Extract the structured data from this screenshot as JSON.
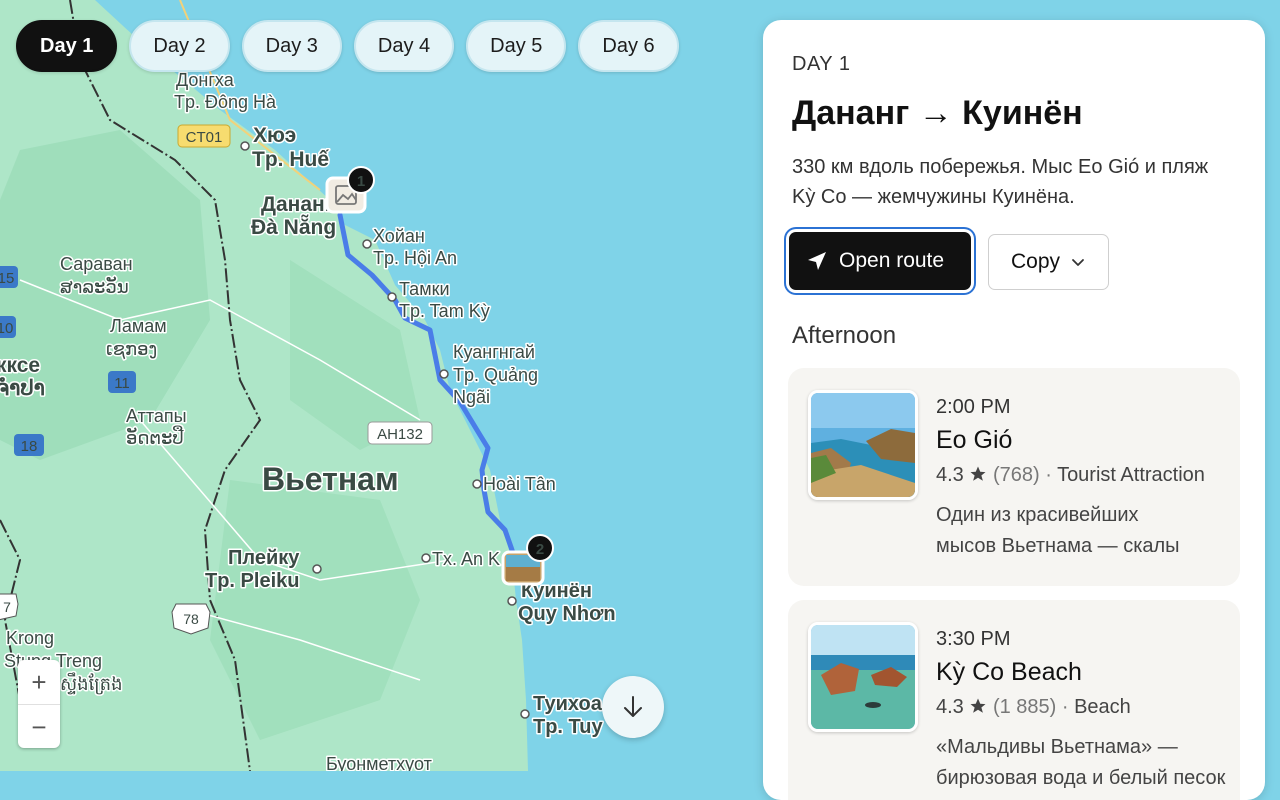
{
  "tabs": [
    "Day 1",
    "Day 2",
    "Day 3",
    "Day 4",
    "Day 5",
    "Day 6"
  ],
  "active_tab": 0,
  "map": {
    "road_badges": [
      "CT01",
      "AH132",
      "15",
      "10",
      "11",
      "18",
      "78",
      "7"
    ],
    "places": {
      "dong_ha_ru": "Донгха",
      "dong_ha": "Tp. Đông Hà",
      "hue_ru": "Хюэ",
      "hue": "Tp. Huế",
      "danang_ru": "Дананг",
      "danang": "Đà Nẵng",
      "hoian_ru": "Хойан",
      "hoian": "Tp. Hội An",
      "tamky_ru": "Тамки",
      "tamky": "Tp. Tam Kỳ",
      "quangngai_ru": "Куангнгай",
      "quangngai_1": "Tp. Quảng",
      "quangngai_2": "Ngãi",
      "saravan_ru": "Сараван",
      "saravan_lo": "ສາລະວັນ",
      "lamam_ru": "Ламам",
      "lamam_lo": "ເຊກອງ",
      "pakse_ru": "кксе",
      "pakse_lo": "ຈຳປາ",
      "attapeu_ru": "Аттапы",
      "attapeu_lo": "ອັດຕະປື",
      "vietnam": "Вьетнам",
      "hoaitan": "Hoài Tân",
      "pleiku_ru": "Плейку",
      "pleiku": "Tp. Pleiku",
      "ankhe": "Tx. An K",
      "quynhon_ru": "Куинён",
      "quynhon": "Quy Nhơn",
      "stung_1": "Krong",
      "stung_2": "Stung Treng",
      "stung_km": "ស្ទឹងត្រែង",
      "tuyhoa_ru": "Туихоа",
      "tuyhoa": "Tp. Tuy",
      "buon_ru": "Буонметхуот"
    },
    "markers": [
      "1",
      "2"
    ],
    "zoom_in": "+",
    "zoom_out": "−"
  },
  "panel": {
    "day_label": "DAY 1",
    "title": "Дананг → Куинён",
    "description": "330 км вдоль побережья. Мыс Eo Gió и пляж Kỳ Co — жемчужины Куинёна.",
    "open_route": "Open route",
    "copy": "Copy",
    "section": "Afternoon",
    "stops": [
      {
        "time": "2:00 PM",
        "name": "Eo Gió",
        "rating": "4.3",
        "reviews": "(768)",
        "category": "Tourist Attraction",
        "description_1": "Один из красивейших",
        "description_2": "мысов Вьетнама — скалы"
      },
      {
        "time": "3:30 PM",
        "name": "Kỳ Co Beach",
        "rating": "4.3",
        "reviews": "(1 885)",
        "category": "Beach",
        "description_1": "«Мальдивы Вьетнама» —",
        "description_2": "бирюзовая вода и белый песок"
      }
    ]
  },
  "colors": {
    "sea": "#7fd3e8",
    "land": "#a9e4c6",
    "route": "#4a7de8",
    "active_tab": "#111111"
  },
  "icons": [
    "navigation-arrow-icon",
    "chevron-down-icon",
    "star-icon",
    "arrow-down-icon",
    "photo-placeholder-icon"
  ]
}
